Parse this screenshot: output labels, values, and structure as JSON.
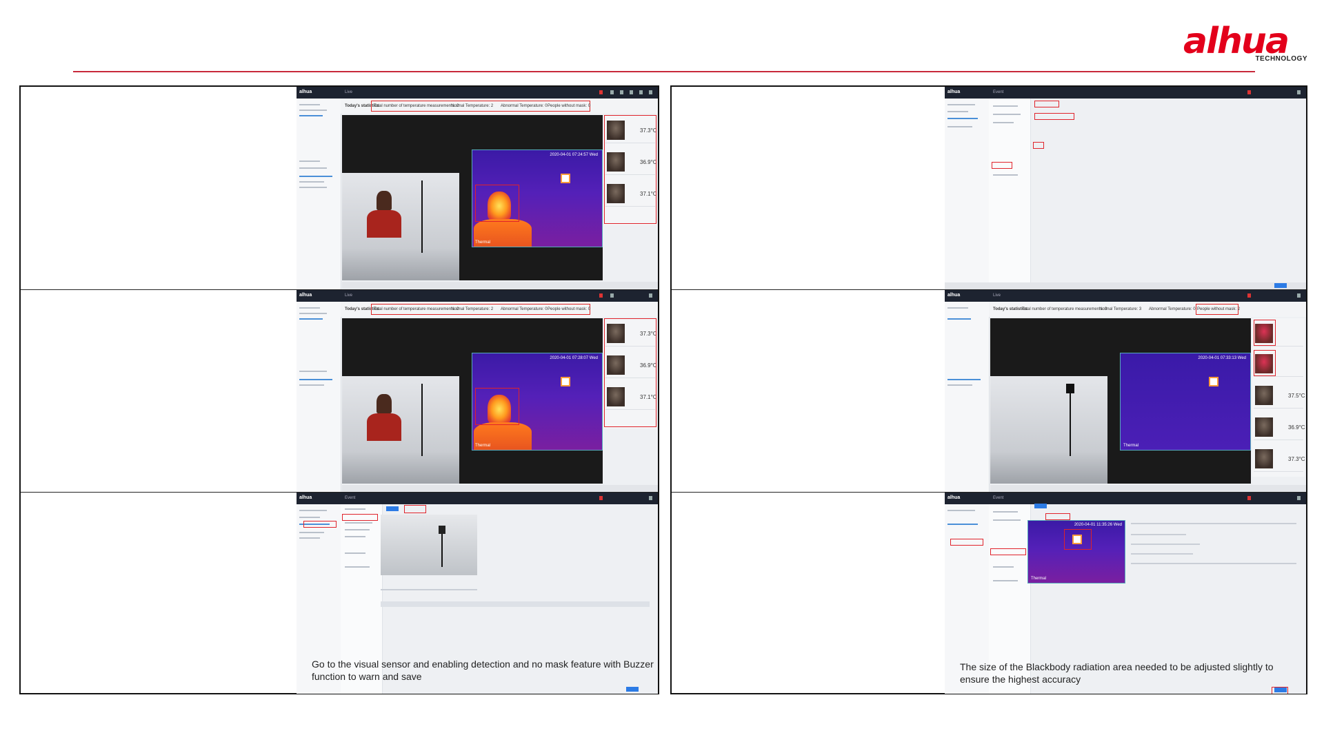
{
  "brand": {
    "logo_text": "alhua",
    "logo_sub": "TECHNOLOGY",
    "accent": "#e3001b"
  },
  "screens": {
    "stats_bar": {
      "label": "Today's statistics",
      "total": "Total number of temperature measurements: 2",
      "normal": "Normal Temperature: 2",
      "abnormal": "Abnormal Temperature: 0",
      "people_mask": "People without mask: 0"
    },
    "stats_bar_b": {
      "label": "Today's statistics",
      "total": "Total number of temperature measurements: 3",
      "normal": "Normal Temperature: 3",
      "abnormal": "Abnormal Temperature: 0",
      "people_mask": "People without mask: 2"
    },
    "timestamps": [
      "2020-04-01 07:24:57 Wed",
      "2020-04-01 07:28:07 Wed",
      "2020-04-01 07:33:13 Wed",
      "2020-04-01 11:35:26 Wed"
    ],
    "temps_a": [
      "37.3°C",
      "36.9°C",
      "37.1°C"
    ],
    "temps_b": [
      "37.5°C",
      "36.9°C",
      "37.3°C"
    ],
    "thermal_label": "Thermal",
    "app_title": "Live",
    "config_title": "Event"
  },
  "captions": {
    "left_bottom": "Go to the visual sensor and enabling detection and no mask feature with Buzzer function to warn and save",
    "right_bottom": "The size of the Blackbody radiation area needed to be adjusted slightly to ensure the highest accuracy"
  },
  "colors": {
    "highlight": "#e0222a",
    "thermal": "#5420b8",
    "topbar": "#1d2330"
  }
}
